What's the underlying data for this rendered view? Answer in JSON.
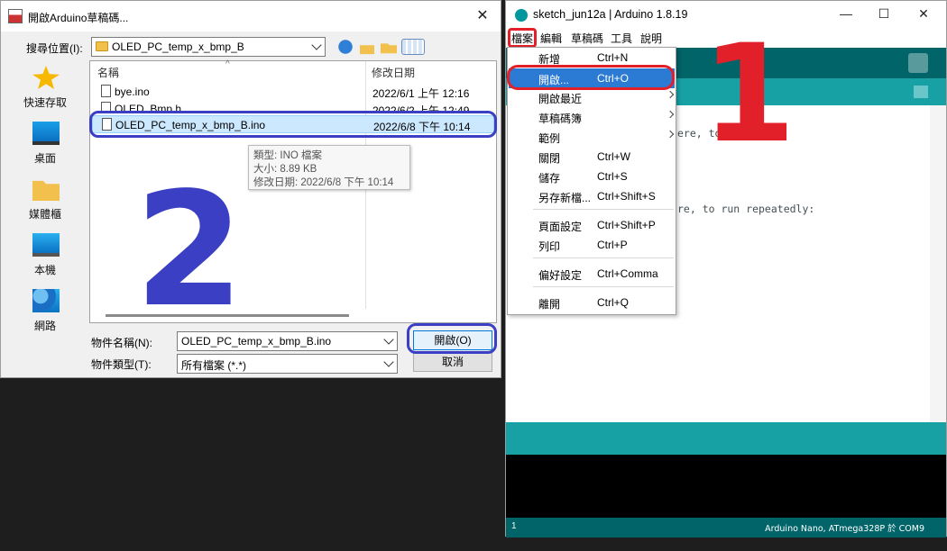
{
  "dialog": {
    "title": "開啟Arduino草稿碼...",
    "look_in_label": "搜尋位置(I):",
    "current_folder": "OLED_PC_temp_x_bmp_B",
    "places": [
      {
        "label": "快速存取",
        "icon": "star-icon"
      },
      {
        "label": "桌面",
        "icon": "desktop-icon"
      },
      {
        "label": "媒體櫃",
        "icon": "library-folder-icon"
      },
      {
        "label": "本機",
        "icon": "computer-icon"
      },
      {
        "label": "網路",
        "icon": "network-icon"
      }
    ],
    "columns": {
      "name": "名稱",
      "modified": "修改日期"
    },
    "files": [
      {
        "name": "bye.ino",
        "modified": "2022/6/1 上午 12:16",
        "selected": false
      },
      {
        "name": "OLED_Bmp.h",
        "modified": "2022/6/2 上午 12:49",
        "selected": false
      },
      {
        "name": "OLED_PC_temp_x_bmp_B.ino",
        "modified": "2022/6/8 下午 10:14",
        "selected": true
      }
    ],
    "tooltip": {
      "type": "類型: INO 檔案",
      "size": "大小: 8.89 KB",
      "modified": "修改日期: 2022/6/8 下午 10:14"
    },
    "filename_label": "物件名稱(N):",
    "filename_value": "OLED_PC_temp_x_bmp_B.ino",
    "filetype_label": "物件類型(T):",
    "filetype_value": "所有檔案 (*.*)",
    "open_button": "開啟(O)",
    "cancel_button": "取消",
    "step_marker": "2"
  },
  "ide": {
    "title": "sketch_jun12a | Arduino 1.8.19",
    "menus": [
      "檔案",
      "編輯",
      "草稿碼",
      "工具",
      "說明"
    ],
    "file_menu": [
      {
        "label": "新增",
        "accel": "Ctrl+N",
        "submenu": false
      },
      {
        "label": "開啟...",
        "accel": "Ctrl+O",
        "submenu": false,
        "active": true
      },
      {
        "label": "開啟最近",
        "accel": "",
        "submenu": true
      },
      {
        "label": "草稿碼簿",
        "accel": "",
        "submenu": true
      },
      {
        "label": "範例",
        "accel": "",
        "submenu": true
      },
      {
        "label": "關閉",
        "accel": "Ctrl+W",
        "submenu": false
      },
      {
        "label": "儲存",
        "accel": "Ctrl+S",
        "submenu": false
      },
      {
        "label": "另存新檔...",
        "accel": "Ctrl+Shift+S",
        "submenu": false
      },
      {
        "label": "頁面設定",
        "accel": "Ctrl+Shift+P",
        "submenu": false
      },
      {
        "label": "列印",
        "accel": "Ctrl+P",
        "submenu": false
      },
      {
        "label": "偏好設定",
        "accel": "Ctrl+Comma",
        "submenu": false
      },
      {
        "label": "離開",
        "accel": "Ctrl+Q",
        "submenu": false
      }
    ],
    "code_lines": [
      "ere, to run once:",
      "re, to run repeatedly:"
    ],
    "footer_line": "1",
    "footer_board": "Arduino Nano, ATmega328P 於 COM9",
    "step_marker": "1",
    "colors": {
      "teal_dark": "#006468",
      "teal": "#17a1a5",
      "menu_highlight": "#2b7bd4",
      "annotation_red": "#e2202a",
      "annotation_blue": "#3b3fc3"
    }
  }
}
